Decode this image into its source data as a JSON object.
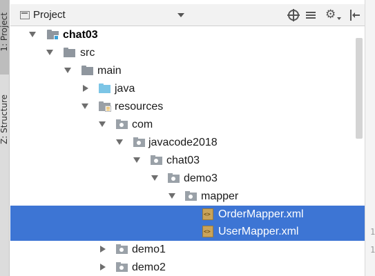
{
  "tool_window": {
    "title": "Project",
    "stripe": {
      "project_tab": "1: Project",
      "structure_tab": "Z: Structure"
    }
  },
  "toolbar": {
    "icons": [
      "locate-icon",
      "collapse-all-icon",
      "gear-icon",
      "hide-icon"
    ]
  },
  "tree": [
    {
      "label": "chat03",
      "depth": 0,
      "expanded": true,
      "icon": "module-folder-icon",
      "bold": true
    },
    {
      "label": "src",
      "depth": 1,
      "expanded": true,
      "icon": "folder-icon"
    },
    {
      "label": "main",
      "depth": 2,
      "expanded": true,
      "icon": "folder-icon"
    },
    {
      "label": "java",
      "depth": 3,
      "expanded": false,
      "icon": "source-folder-icon"
    },
    {
      "label": "resources",
      "depth": 3,
      "expanded": true,
      "icon": "resources-folder-icon"
    },
    {
      "label": "com",
      "depth": 4,
      "expanded": true,
      "icon": "package-icon"
    },
    {
      "label": "javacode2018",
      "depth": 5,
      "expanded": true,
      "icon": "package-icon"
    },
    {
      "label": "chat03",
      "depth": 6,
      "expanded": true,
      "icon": "package-icon"
    },
    {
      "label": "demo3",
      "depth": 7,
      "expanded": true,
      "icon": "package-icon"
    },
    {
      "label": "mapper",
      "depth": 8,
      "expanded": true,
      "icon": "package-icon"
    },
    {
      "label": "OrderMapper.xml",
      "depth": 9,
      "icon": "xml-file-icon",
      "selected": true
    },
    {
      "label": "UserMapper.xml",
      "depth": 9,
      "icon": "xml-file-icon",
      "selected": true
    },
    {
      "label": "demo1",
      "depth": 4,
      "expanded": false,
      "icon": "package-icon"
    },
    {
      "label": "demo2",
      "depth": 4,
      "expanded": false,
      "icon": "package-icon"
    }
  ],
  "gutter_numbers": [
    "1",
    "1"
  ],
  "colors": {
    "selection": "#3d75d4",
    "source_folder": "#7cc5e6",
    "folder": "#8f969e"
  }
}
